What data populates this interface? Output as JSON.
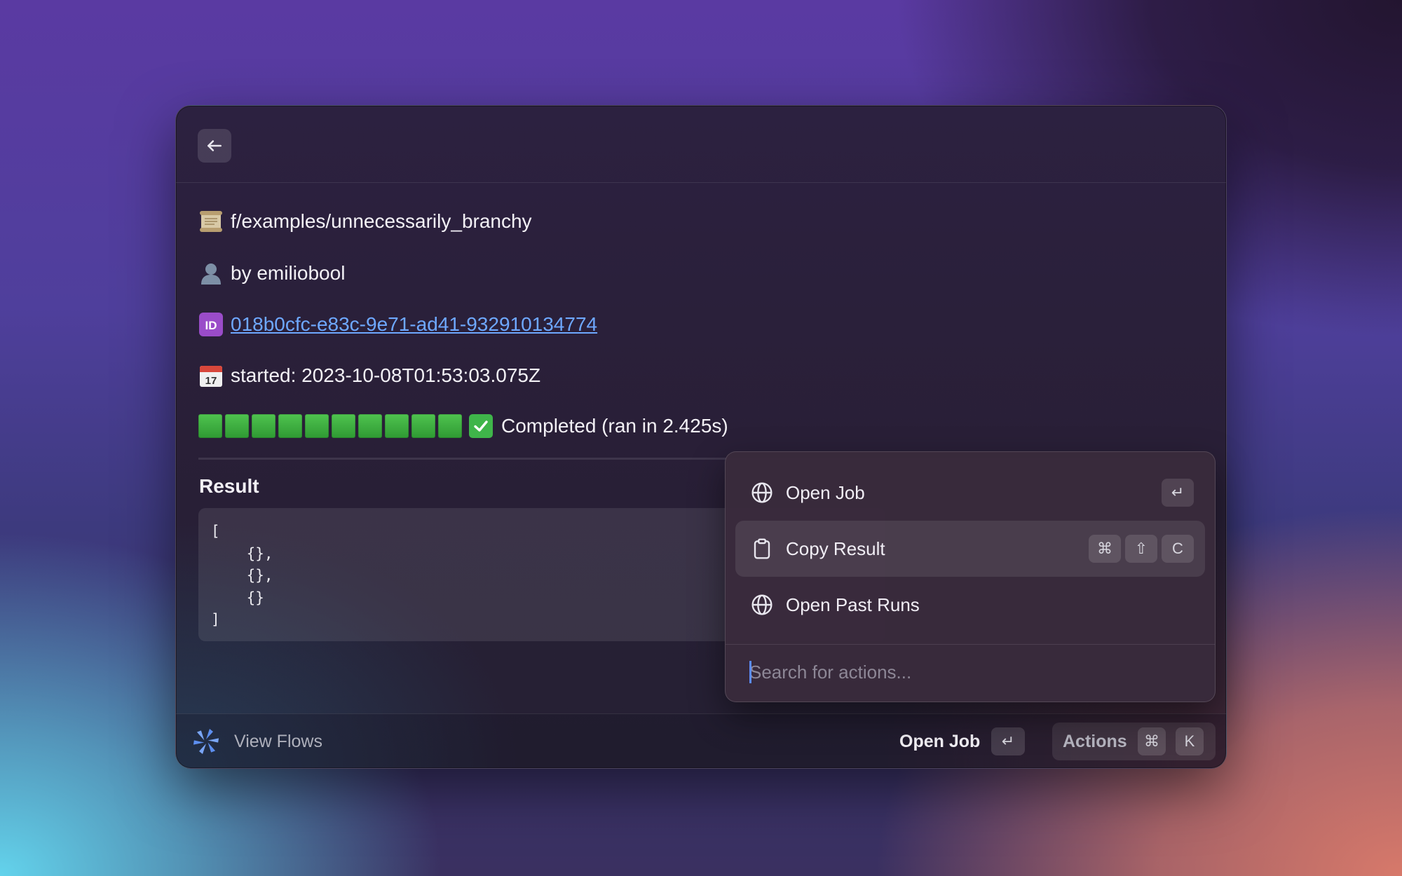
{
  "window": {
    "back_icon": "arrow-left-icon"
  },
  "details": {
    "path": {
      "icon": "scroll-icon",
      "text": "f/examples/unnecessarily_branchy"
    },
    "author": {
      "icon": "user-icon",
      "text": "by emiliobool"
    },
    "id": {
      "icon": "id-icon",
      "text": "018b0cfc-e83c-9e71-ad41-932910134774"
    },
    "started": {
      "icon": "calendar-icon",
      "text": "started: 2023-10-08T01:53:03.075Z"
    },
    "status": {
      "blocks": 10,
      "icon": "check-mark-icon",
      "text": "Completed (ran in 2.425s)"
    }
  },
  "result": {
    "label": "Result",
    "code": "[\n    {},\n    {},\n    {}\n]"
  },
  "footer": {
    "title": "View Flows",
    "primary_action": "Open Job",
    "primary_key": "↵",
    "actions_label": "Actions",
    "actions_keys": [
      "⌘",
      "K"
    ]
  },
  "menu": {
    "items": [
      {
        "icon": "globe-icon",
        "label": "Open Job",
        "keys": [
          "↵"
        ],
        "selected": false
      },
      {
        "icon": "clipboard-icon",
        "label": "Copy Result",
        "keys": [
          "⌘",
          "⇧",
          "C"
        ],
        "selected": true
      },
      {
        "icon": "globe-icon",
        "label": "Open Past Runs",
        "keys": [],
        "selected": false
      }
    ],
    "search_placeholder": "Search for actions..."
  },
  "colors": {
    "link": "#6ea8ff",
    "progress": "#3fb54a",
    "caret": "#5b8cff"
  }
}
